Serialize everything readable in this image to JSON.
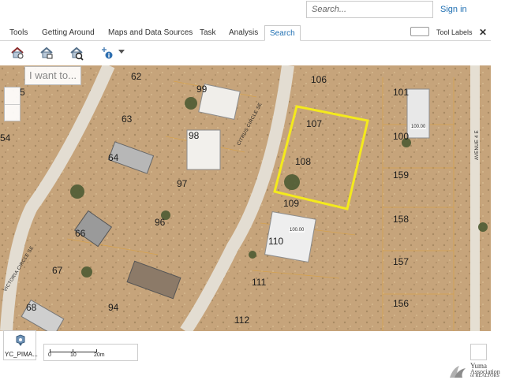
{
  "header": {
    "search_placeholder": "Search...",
    "signin_label": "Sign in"
  },
  "tabs": [
    {
      "label": "Tools"
    },
    {
      "label": "Getting Around"
    },
    {
      "label": "Maps and Data Sources"
    },
    {
      "label": "Task"
    },
    {
      "label": "Analysis"
    },
    {
      "label": "Search",
      "active": true
    }
  ],
  "tool_labels_text": "Tool Labels",
  "close_glyph": "✕",
  "toolbar": {
    "icons": [
      "house-search-icon",
      "house-select-icon",
      "house-zoom-icon",
      "identify-icon",
      "dropdown-caret"
    ]
  },
  "map": {
    "iwant_placeholder": "I want to...",
    "parcels": [
      {
        "label": "62"
      },
      {
        "label": "99"
      },
      {
        "label": "106"
      },
      {
        "label": "101"
      },
      {
        "label": "5"
      },
      {
        "label": "63"
      },
      {
        "label": "107"
      },
      {
        "label": "100"
      },
      {
        "label": "54"
      },
      {
        "label": "98"
      },
      {
        "label": "64"
      },
      {
        "label": "108"
      },
      {
        "label": "159"
      },
      {
        "label": "97"
      },
      {
        "label": "109"
      },
      {
        "label": "158"
      },
      {
        "label": "96"
      },
      {
        "label": "66"
      },
      {
        "label": "110"
      },
      {
        "label": "157"
      },
      {
        "label": "67"
      },
      {
        "label": "111"
      },
      {
        "label": "156"
      },
      {
        "label": "94"
      },
      {
        "label": "68"
      },
      {
        "label": "112"
      }
    ],
    "road_labels": {
      "citrus": "CITRUS CIRCLE SE",
      "victoria": "VICTORIA CIRCLE SE",
      "avenue": "AVENUE 4 E"
    },
    "area_tags": [
      "100.00",
      "100.00"
    ],
    "selected_parcel": "108",
    "highlight_color": "#f4ea1c"
  },
  "basemap": {
    "label": "YC_PIMA..."
  },
  "scalebar": {
    "labels": [
      "0",
      "10",
      "20m"
    ]
  },
  "logo": {
    "line1": "Yuma",
    "line2": "Association",
    "line3": "of REALTORS"
  }
}
